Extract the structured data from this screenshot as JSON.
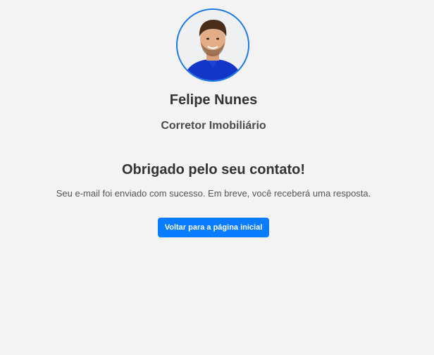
{
  "profile": {
    "avatar_icon": "profile-photo",
    "name": "Felipe Nunes",
    "role": "Corretor Imobiliário"
  },
  "confirmation": {
    "title": "Obrigado pelo seu contato!",
    "message": "Seu e-mail foi enviado com sucesso. Em breve, você receberá uma resposta."
  },
  "actions": {
    "back_home_label": "Voltar para a página inicial"
  },
  "colors": {
    "background": "#f3f3f3",
    "accent": "#0a7cff",
    "avatar_border": "#1877e8",
    "heading_text": "#333333",
    "body_text": "#555555"
  }
}
